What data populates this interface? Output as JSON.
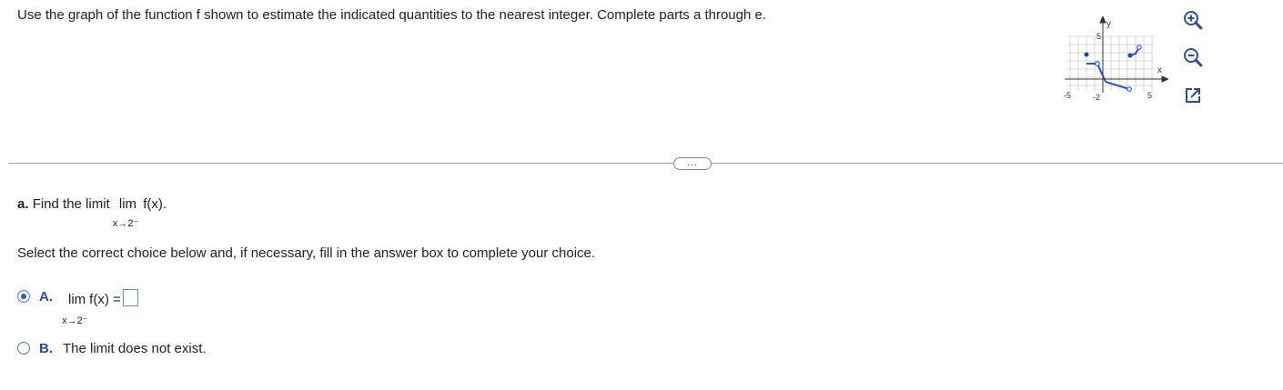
{
  "instructions": "Use the graph of the function f shown to estimate the indicated quantities to the nearest integer. Complete parts a through e.",
  "graph": {
    "y_axis_label": "y",
    "x_axis_label": "x",
    "y_tick_label": "5",
    "x_tick_neg": "-5",
    "x_tick_neg2": "-2",
    "x_tick_pos": "5"
  },
  "toolbar": {
    "zoom_in_icon": "zoom-in-icon",
    "zoom_out_icon": "zoom-out-icon",
    "popout_icon": "popout-icon"
  },
  "more_button": "...",
  "part_a": {
    "letter": "a.",
    "prompt": "Find the limit",
    "lim": "lim",
    "func": "f(x).",
    "sub": "x→2⁻"
  },
  "select_text": "Select the correct choice below and, if necessary, fill in the answer box to complete your choice.",
  "choices": [
    {
      "letter": "A.",
      "lim": "lim",
      "func": "f(x) =",
      "sub": "x→2⁻",
      "selected": true,
      "answer_value": ""
    },
    {
      "letter": "B.",
      "text": "The limit does not exist.",
      "selected": false
    }
  ],
  "colors": {
    "accent": "#2a4f9a",
    "graph_line": "#1a3ee6",
    "radio": "#4a7cc9"
  }
}
